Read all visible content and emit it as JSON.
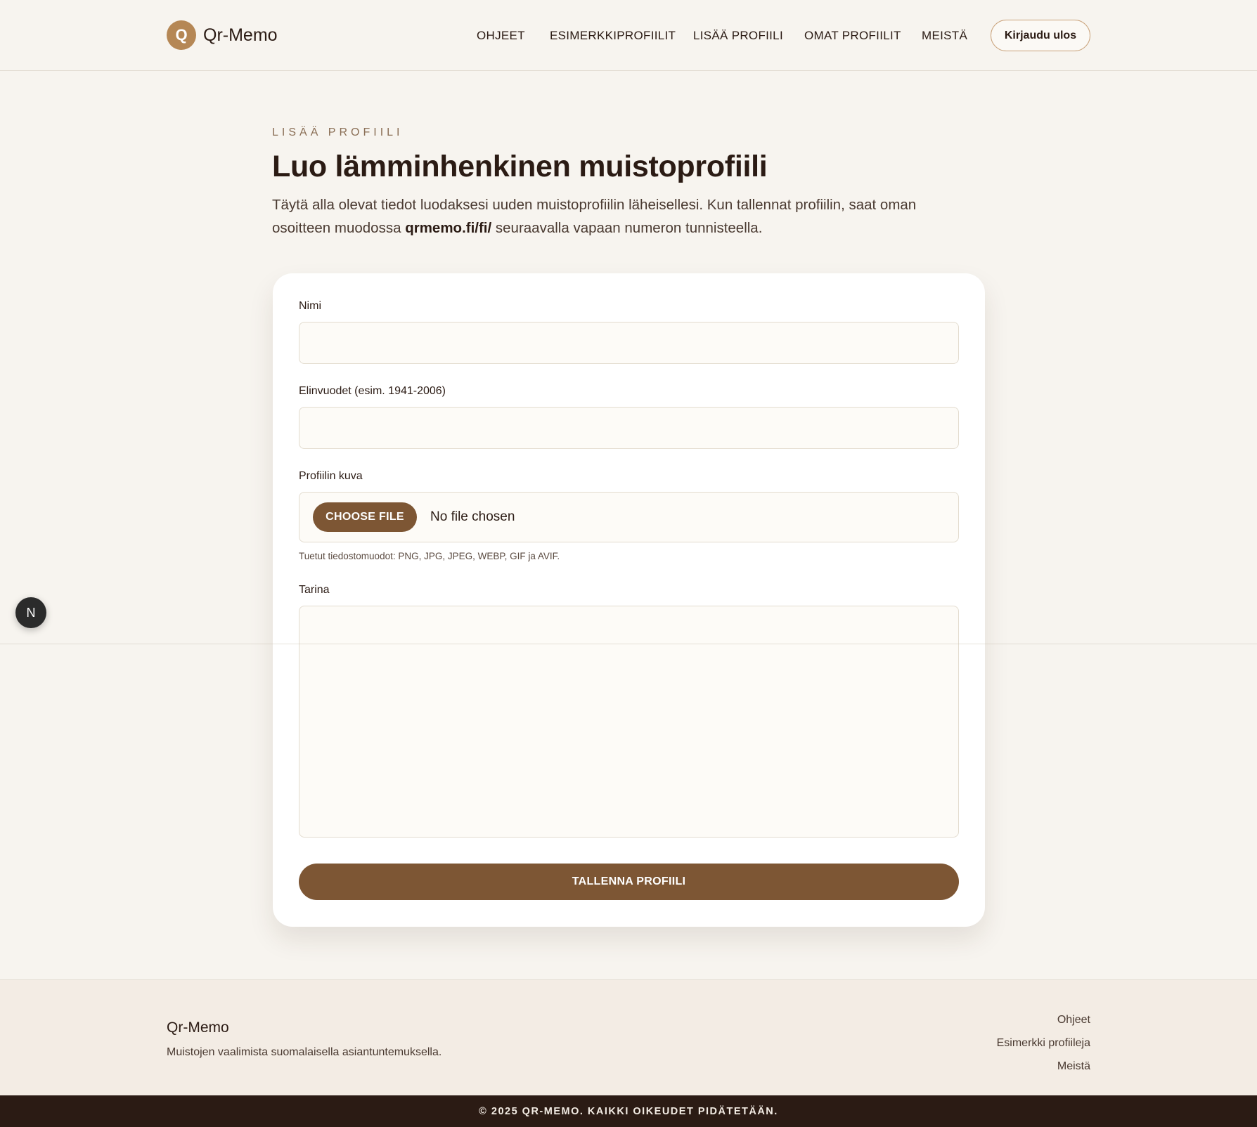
{
  "header": {
    "logo_letter": "Q",
    "brand": "Qr-Memo",
    "nav": [
      "OHJEET",
      "ESIMERKKIPROFIILIT",
      "LISÄÄ PROFIILI",
      "OMAT PROFIILIT",
      "MEISTÄ"
    ],
    "logout_label": "Kirjaudu ulos"
  },
  "main": {
    "eyebrow": "LISÄÄ PROFIILI",
    "title": "Luo lämminhenkinen muistoprofiili",
    "intro_part1": "Täytä alla olevat tiedot luodaksesi uuden muistoprofiilin läheisellesi. Kun tallennat profiilin, saat oman osoitteen muodossa",
    "intro_domain": "qrmemo.fi/fi/",
    "intro_part2": "seuraavalla vapaan numeron tunnisteella."
  },
  "form": {
    "name_label": "Nimi",
    "name_value": "",
    "years_label": "Elinvuodet (esim. 1941-2006)",
    "years_value": "",
    "image_label": "Profiilin kuva",
    "choose_file_label": "CHOOSE FILE",
    "file_status": "No file chosen",
    "file_hint": "Tuetut tiedostomuodot: PNG, JPG, JPEG, WEBP, GIF ja AVIF.",
    "story_label": "Tarina",
    "story_value": "",
    "save_label": "TALLENNA PROFIILI"
  },
  "floating_badge": "N",
  "footer": {
    "brand": "Qr-Memo",
    "tagline": "Muistojen vaalimista suomalaisella asiantuntemuksella.",
    "links": [
      "Ohjeet",
      "Esimerkki profiileja",
      "Meistä"
    ],
    "copyright": "© 2025 QR-MEMO. KAIKKI OIKEUDET PIDÄTETÄÄN."
  },
  "colors": {
    "background": "#f7f4ef",
    "accent_brown": "#7d5634",
    "logo_tan": "#b58755",
    "text_dark": "#2b1b14",
    "footer_bar": "#2b1b14"
  }
}
